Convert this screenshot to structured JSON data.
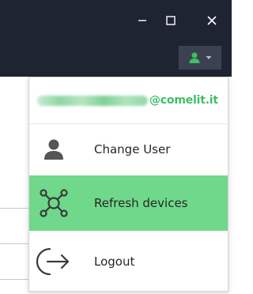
{
  "titlebar": {
    "minimize_icon": "minimize-icon",
    "maximize_icon": "maximize-icon",
    "close_icon": "close-icon",
    "background_color": "#1f2433"
  },
  "user_menu_button": {
    "icon": "user-icon",
    "caret": "chevron-down-icon",
    "icon_color": "#3fbf66"
  },
  "dropdown": {
    "email_domain": "@comelit.it",
    "items": [
      {
        "label": "Change User",
        "icon": "user-icon"
      },
      {
        "label": "Refresh devices",
        "icon": "network-nodes-icon",
        "highlighted": true,
        "highlight_color": "#6fd88a"
      },
      {
        "label": "Logout",
        "icon": "logout-icon"
      }
    ]
  }
}
